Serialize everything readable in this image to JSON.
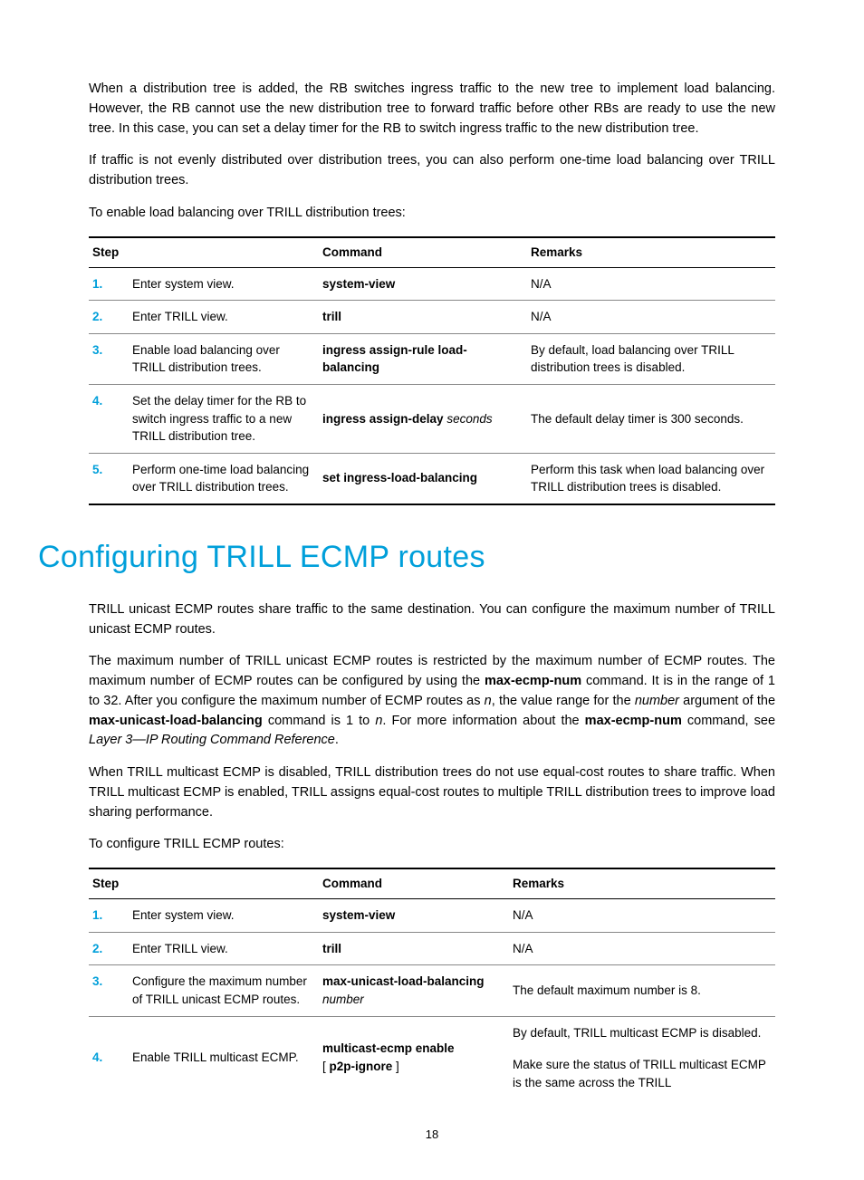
{
  "para1": "When a distribution tree is added, the RB switches ingress traffic to the new tree to implement load balancing. However, the RB cannot use the new distribution tree to forward traffic before other RBs are ready to use the new tree. In this case, you can set a delay timer for the RB to switch ingress traffic to the new distribution tree.",
  "para2": "If traffic is not evenly distributed over distribution trees, you can also perform one-time load balancing over TRILL distribution trees.",
  "para3": "To enable load balancing over TRILL distribution trees:",
  "table1": {
    "headers": {
      "step": "Step",
      "command": "Command",
      "remarks": "Remarks"
    },
    "rows": [
      {
        "n": "1.",
        "step": "Enter system view.",
        "cmd_b": "system-view",
        "cmd_i": "",
        "remarks": "N/A"
      },
      {
        "n": "2.",
        "step": "Enter TRILL view.",
        "cmd_b": "trill",
        "cmd_i": "",
        "remarks": "N/A"
      },
      {
        "n": "3.",
        "step": "Enable load balancing over TRILL distribution trees.",
        "cmd_b": "ingress assign-rule load-balancing",
        "cmd_i": "",
        "remarks": "By default, load balancing over TRILL distribution trees is disabled."
      },
      {
        "n": "4.",
        "step": "Set the delay timer for the RB to switch ingress traffic to a new TRILL distribution tree.",
        "cmd_b": "ingress assign-delay",
        "cmd_i": " seconds",
        "remarks": "The default delay timer is 300 seconds."
      },
      {
        "n": "5.",
        "step": "Perform one-time load balancing over TRILL distribution trees.",
        "cmd_b": "set ingress-load-balancing",
        "cmd_i": "",
        "remarks": "Perform this task when load balancing over TRILL distribution trees is disabled."
      }
    ]
  },
  "heading1": "Configuring TRILL ECMP routes",
  "para4": "TRILL unicast ECMP routes share traffic to the same destination. You can configure the maximum number of TRILL unicast ECMP routes.",
  "para5": {
    "t1": "The maximum number of TRILL unicast ECMP routes is restricted by the maximum number of ECMP routes. The maximum number of ECMP routes can be configured by using the ",
    "b1": "max-ecmp-num",
    "t2": " command. It is in the range of 1 to 32. After you configure the maximum number of ECMP routes as ",
    "i1": "n",
    "t3": ", the value range for the ",
    "i2": "number",
    "t4": " argument of the ",
    "b2": "max-unicast-load-balancing",
    "t5": " command is 1 to ",
    "i3": "n",
    "t6": ". For more information about the ",
    "b3": "max-ecmp-num",
    "t7": " command, see ",
    "i4": "Layer 3—IP Routing Command Reference",
    "t8": "."
  },
  "para6": "When TRILL multicast ECMP is disabled, TRILL distribution trees do not use equal-cost routes to share traffic. When TRILL multicast ECMP is enabled, TRILL assigns equal-cost routes to multiple TRILL distribution trees to improve load sharing performance.",
  "para7": "To configure TRILL ECMP routes:",
  "table2": {
    "headers": {
      "step": "Step",
      "command": "Command",
      "remarks": "Remarks"
    },
    "rows": [
      {
        "n": "1.",
        "step": "Enter system view.",
        "cmd_b": "system-view",
        "cmd_i": "",
        "remarks": "N/A"
      },
      {
        "n": "2.",
        "step": "Enter TRILL view.",
        "cmd_b": "trill",
        "cmd_i": "",
        "remarks": "N/A"
      },
      {
        "n": "3.",
        "step": "Configure the maximum number of TRILL unicast ECMP routes.",
        "cmd_b": "max-unicast-load-balancing",
        "cmd_i": "number",
        "remarks": "The default maximum number is 8."
      }
    ],
    "row4": {
      "n": "4.",
      "step": "Enable TRILL multicast ECMP.",
      "cmd_line1_b": "multicast-ecmp enable",
      "cmd_line2_pre": "[ ",
      "cmd_line2_b": "p2p-ignore",
      "cmd_line2_post": " ]",
      "remarks_a": "By default, TRILL multicast ECMP is disabled.",
      "remarks_b": "Make sure the status of TRILL multicast ECMP is the same across the TRILL"
    }
  },
  "pagenum": "18"
}
